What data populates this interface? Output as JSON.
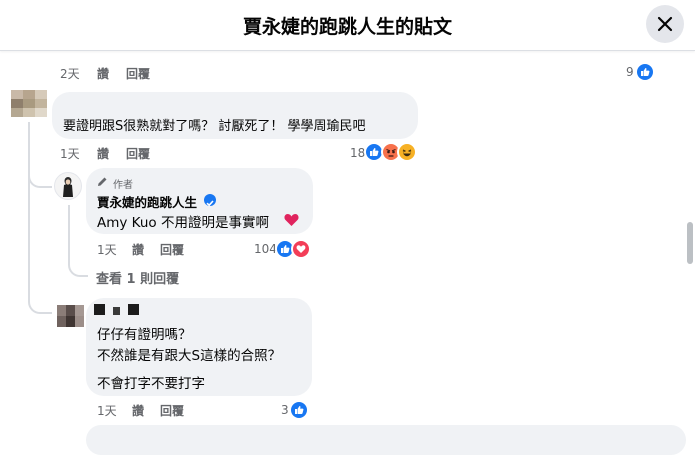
{
  "header": {
    "title": "賈永婕的跑跳人生的貼文",
    "close_icon": "close-icon"
  },
  "comment0": {
    "time": "2天",
    "like": "讚",
    "reply": "回覆",
    "reaction_count": "9",
    "reactions": [
      "like-icon"
    ]
  },
  "comment1": {
    "text": "要證明跟S很熟就對了嗎？ 討厭死了！ 學學周瑜民吧",
    "time": "1天",
    "like": "讚",
    "reply": "回覆",
    "reaction_count": "18",
    "reactions": [
      "like-icon",
      "angry-icon",
      "haha-icon"
    ]
  },
  "reply1": {
    "badge": "作者",
    "author": "賈永婕的跑跳人生",
    "mention": "Amy Kuo",
    "text": " 不用證明是事實啊",
    "time": "1天",
    "like": "讚",
    "reply": "回覆",
    "reaction_count": "104",
    "reactions": [
      "like-icon",
      "love-icon"
    ],
    "view_replies": "查看 1 則回覆"
  },
  "comment2": {
    "line1": "仔仔有證明嗎？",
    "line2": "不然誰是有跟大S這樣的合照？",
    "line3": "不會打字不要打字",
    "time": "1天",
    "like": "讚",
    "reply": "回覆",
    "reaction_count": "3",
    "reactions": [
      "like-icon"
    ]
  },
  "colors": {
    "facebook_blue": "#1877f2",
    "love_red": "#f33e58",
    "bubble_gray": "#f0f2f5",
    "meta_gray": "#65676b"
  }
}
